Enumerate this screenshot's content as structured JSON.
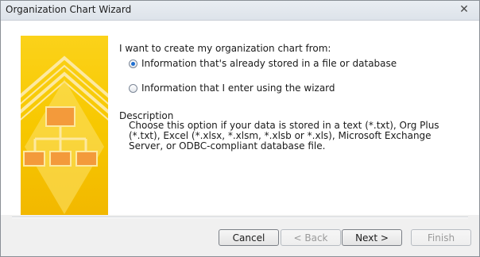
{
  "window": {
    "title": "Organization Chart Wizard",
    "close_glyph": "✕"
  },
  "wizard": {
    "prompt": "I want to create my organization chart from:",
    "options": [
      {
        "label": "Information that's already stored in a file or database",
        "selected": true
      },
      {
        "label": "Information that I enter using the wizard",
        "selected": false
      }
    ],
    "description_title": "Description",
    "description_text": "Choose this option if your data is stored in a text (*.txt), Org Plus (*.txt), Excel (*.xlsx, *.xlsm, *.xlsb or *.xls), Microsoft Exchange Server, or ODBC-compliant database file."
  },
  "buttons": {
    "cancel": "Cancel",
    "back": "< Back",
    "next": "Next >",
    "finish": "Finish"
  },
  "colors": {
    "illustration_yellow": "#f7d000",
    "illustration_light": "#fde26a",
    "selected_dot": "#1f6fd1"
  },
  "icons": {
    "close": "close-icon",
    "illustration": "org-chart-illustration"
  }
}
